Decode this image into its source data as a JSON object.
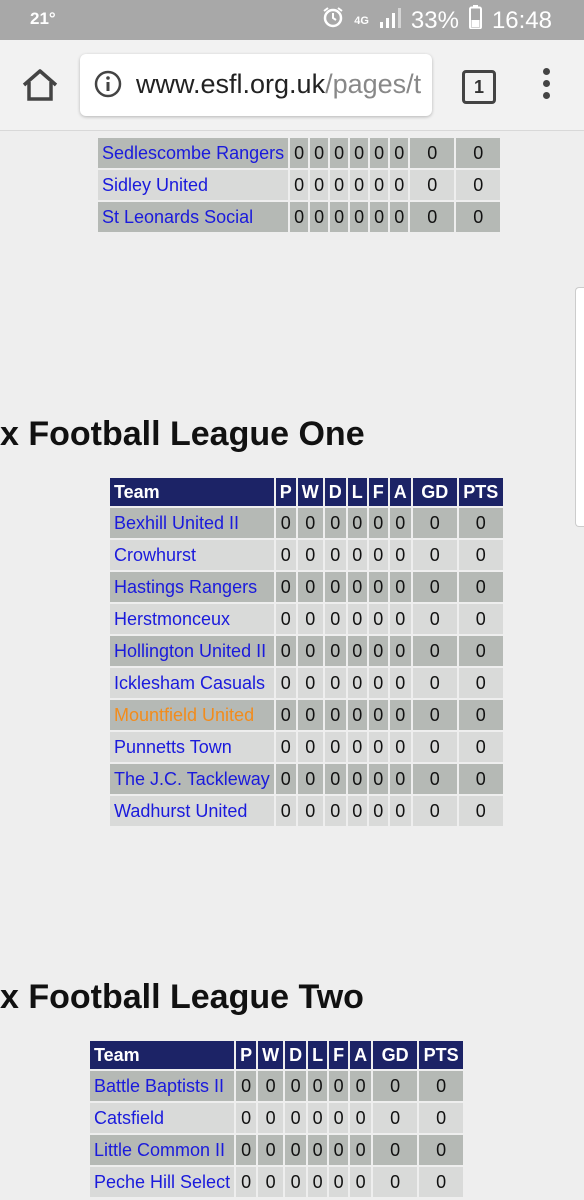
{
  "status": {
    "temp": "21°",
    "network": "4G",
    "battery": "33%",
    "time": "16:48"
  },
  "browser": {
    "url_host": "www.esfl.org.uk",
    "url_path": "/pages/t",
    "tab_count": "1"
  },
  "colors": {
    "header": "#1c2366",
    "link": "#1a1adc",
    "highlight": "#f28c1c"
  },
  "table_top": {
    "rows": [
      {
        "team": "Sedlescombe Rangers",
        "p": "0",
        "w": "0",
        "d": "0",
        "l": "0",
        "f": "0",
        "a": "0",
        "gd": "0",
        "pts": "0"
      },
      {
        "team": "Sidley United",
        "p": "0",
        "w": "0",
        "d": "0",
        "l": "0",
        "f": "0",
        "a": "0",
        "gd": "0",
        "pts": "0"
      },
      {
        "team": "St Leonards Social",
        "p": "0",
        "w": "0",
        "d": "0",
        "l": "0",
        "f": "0",
        "a": "0",
        "gd": "0",
        "pts": "0"
      }
    ]
  },
  "league_one": {
    "heading": "x Football League One",
    "headers": [
      "Team",
      "P",
      "W",
      "D",
      "L",
      "F",
      "A",
      "GD",
      "PTS"
    ],
    "rows": [
      {
        "team": "Bexhill United II",
        "p": "0",
        "w": "0",
        "d": "0",
        "l": "0",
        "f": "0",
        "a": "0",
        "gd": "0",
        "pts": "0"
      },
      {
        "team": "Crowhurst",
        "p": "0",
        "w": "0",
        "d": "0",
        "l": "0",
        "f": "0",
        "a": "0",
        "gd": "0",
        "pts": "0"
      },
      {
        "team": "Hastings Rangers",
        "p": "0",
        "w": "0",
        "d": "0",
        "l": "0",
        "f": "0",
        "a": "0",
        "gd": "0",
        "pts": "0"
      },
      {
        "team": "Herstmonceux",
        "p": "0",
        "w": "0",
        "d": "0",
        "l": "0",
        "f": "0",
        "a": "0",
        "gd": "0",
        "pts": "0"
      },
      {
        "team": "Hollington United II",
        "p": "0",
        "w": "0",
        "d": "0",
        "l": "0",
        "f": "0",
        "a": "0",
        "gd": "0",
        "pts": "0"
      },
      {
        "team": "Icklesham Casuals",
        "p": "0",
        "w": "0",
        "d": "0",
        "l": "0",
        "f": "0",
        "a": "0",
        "gd": "0",
        "pts": "0"
      },
      {
        "team": "Mountfield United",
        "p": "0",
        "w": "0",
        "d": "0",
        "l": "0",
        "f": "0",
        "a": "0",
        "gd": "0",
        "pts": "0",
        "highlight": true
      },
      {
        "team": "Punnetts Town",
        "p": "0",
        "w": "0",
        "d": "0",
        "l": "0",
        "f": "0",
        "a": "0",
        "gd": "0",
        "pts": "0"
      },
      {
        "team": "The J.C. Tackleway",
        "p": "0",
        "w": "0",
        "d": "0",
        "l": "0",
        "f": "0",
        "a": "0",
        "gd": "0",
        "pts": "0"
      },
      {
        "team": "Wadhurst United",
        "p": "0",
        "w": "0",
        "d": "0",
        "l": "0",
        "f": "0",
        "a": "0",
        "gd": "0",
        "pts": "0"
      }
    ]
  },
  "league_two": {
    "heading": "x Football League Two",
    "headers": [
      "Team",
      "P",
      "W",
      "D",
      "L",
      "F",
      "A",
      "GD",
      "PTS"
    ],
    "rows": [
      {
        "team": "Battle Baptists II",
        "p": "0",
        "w": "0",
        "d": "0",
        "l": "0",
        "f": "0",
        "a": "0",
        "gd": "0",
        "pts": "0"
      },
      {
        "team": "Catsfield",
        "p": "0",
        "w": "0",
        "d": "0",
        "l": "0",
        "f": "0",
        "a": "0",
        "gd": "0",
        "pts": "0"
      },
      {
        "team": "Little Common II",
        "p": "0",
        "w": "0",
        "d": "0",
        "l": "0",
        "f": "0",
        "a": "0",
        "gd": "0",
        "pts": "0"
      },
      {
        "team": "Peche Hill Select",
        "p": "0",
        "w": "0",
        "d": "0",
        "l": "0",
        "f": "0",
        "a": "0",
        "gd": "0",
        "pts": "0"
      }
    ]
  }
}
